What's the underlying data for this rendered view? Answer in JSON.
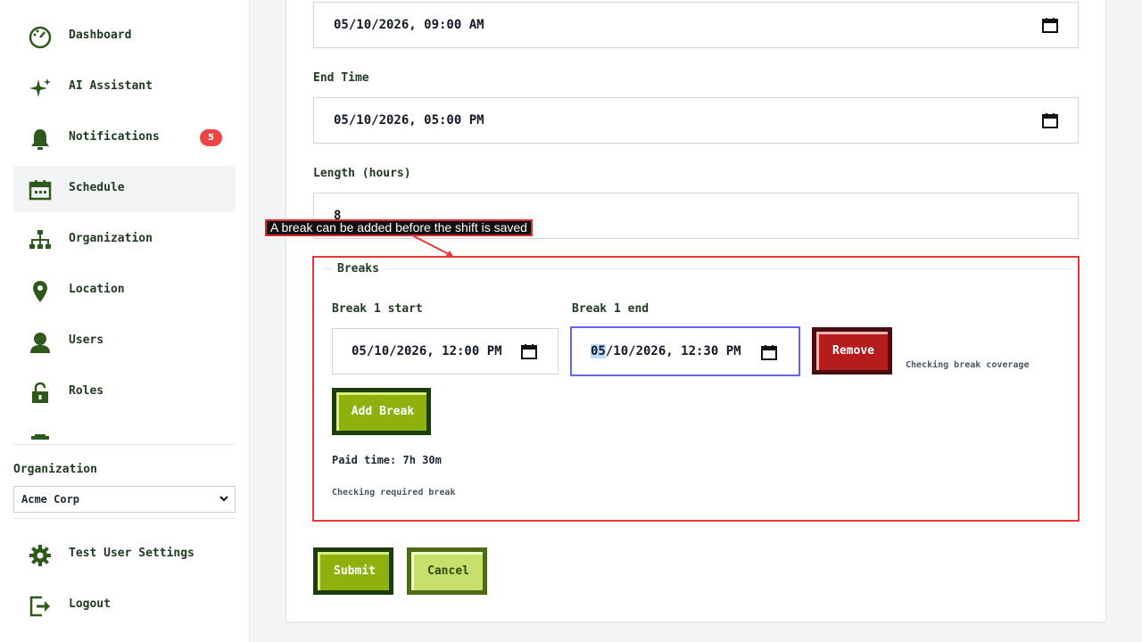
{
  "sidebar": {
    "items": [
      {
        "label": "Dashboard",
        "icon": "dashboard-icon"
      },
      {
        "label": "AI Assistant",
        "icon": "sparkle-icon"
      },
      {
        "label": "Notifications",
        "icon": "bell-icon",
        "badge": "5"
      },
      {
        "label": "Schedule",
        "icon": "calendar-icon",
        "active": true
      },
      {
        "label": "Organization",
        "icon": "org-chart-icon"
      },
      {
        "label": "Location",
        "icon": "map-pin-icon"
      },
      {
        "label": "Users",
        "icon": "user-icon"
      },
      {
        "label": "Roles",
        "icon": "lock-icon"
      }
    ],
    "organization_label": "Organization",
    "organization_selected": "Acme Corp",
    "footer": [
      {
        "label": "Test User Settings",
        "icon": "gear-icon"
      },
      {
        "label": "Logout",
        "icon": "logout-icon"
      }
    ]
  },
  "form": {
    "start_time_value": "05/10/2026, 09:00 AM",
    "end_time_label": "End Time",
    "end_time_value": "05/10/2026, 05:00 PM",
    "length_label": "Length (hours)",
    "length_value": "8",
    "breaks": {
      "legend": "Breaks",
      "break1_start_label": "Break 1 start",
      "break1_start_value": "05/10/2026, 12:00 PM",
      "break1_end_label": "Break 1 end",
      "break1_end_value_selected": "05",
      "break1_end_value_rest": "/10/2026, 12:30 PM",
      "remove_label": "Remove",
      "coverage_hint": "Checking break coverage",
      "add_break_label": "Add Break",
      "paid_time": "Paid time: 7h 30m",
      "required_hint": "Checking required break"
    },
    "submit_label": "Submit",
    "cancel_label": "Cancel"
  },
  "annotation": {
    "tooltip": "A break can be added before the shift is saved"
  },
  "colors": {
    "accent_green": "#8fb10e",
    "dark_green": "#1f3d0c",
    "danger_red": "#b71c1c",
    "badge_red": "#ef4444",
    "focus_blue": "#6366f1",
    "annotation_red": "#e53935"
  }
}
